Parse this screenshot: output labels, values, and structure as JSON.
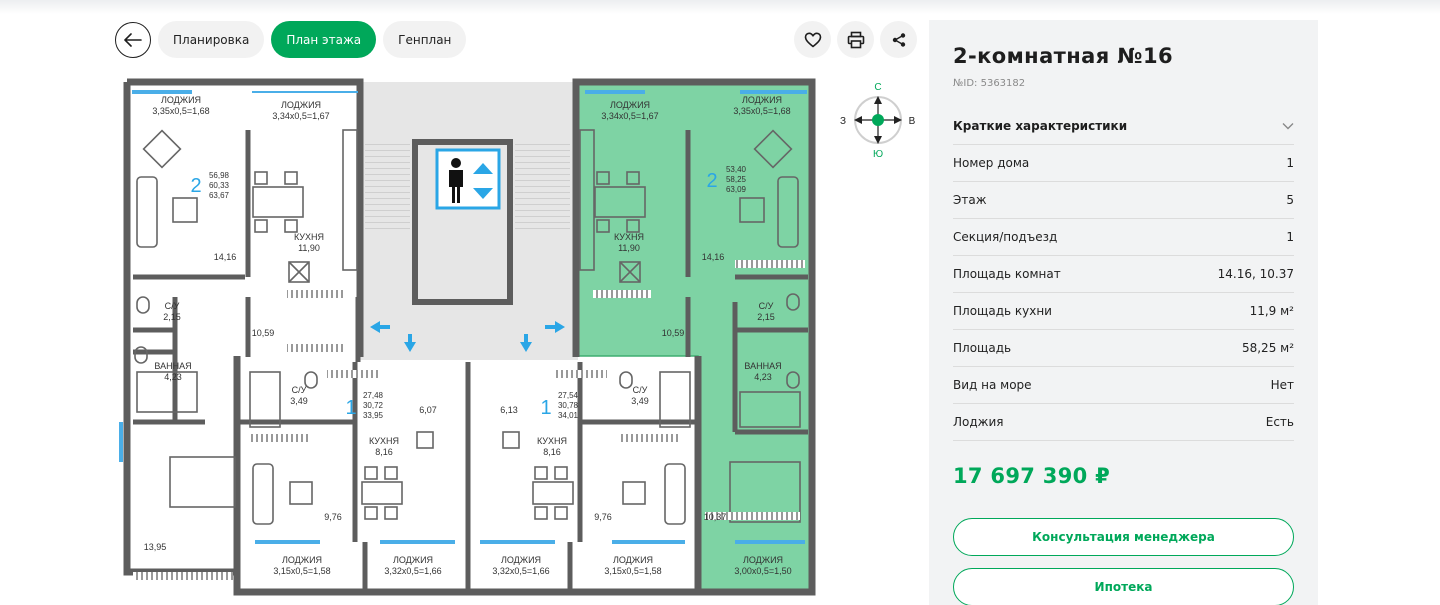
{
  "tabs": [
    {
      "label": "Планировка",
      "active": false
    },
    {
      "label": "План этажа",
      "active": true
    },
    {
      "label": "Генплан",
      "active": false
    }
  ],
  "icons": {
    "back": "arrow-left-icon",
    "favorite": "heart-icon",
    "print": "printer-icon",
    "share": "share-icon",
    "collapse": "chevron-down-icon"
  },
  "colors": {
    "accent": "#00a85a",
    "highlight": "#7ed3a4",
    "window": "#4aaee8"
  },
  "compass": {
    "n": "С",
    "s": "Ю",
    "w": "З",
    "e": "В"
  },
  "plan": {
    "left_loggia_1": "ЛОДЖИЯ",
    "left_loggia_1_size": "3,35х0,5=1,68",
    "left_loggia_2": "ЛОДЖИЯ",
    "left_loggia_2_size": "3,34х0,5=1,67",
    "right_loggia_1": "ЛОДЖИЯ",
    "right_loggia_1_size": "3,34х0,5=1,67",
    "right_loggia_2": "ЛОДЖИЯ",
    "right_loggia_2_size": "3,35х0,5=1,68",
    "left_rooms": "2",
    "left_area_1": "56,98",
    "left_area_2": "60,33",
    "left_area_3": "63,67",
    "right_rooms": "2",
    "right_area_1": "53,40",
    "right_area_2": "58,25",
    "right_area_3": "63,09",
    "left_kitchen": "КУХНЯ",
    "left_kitchen_area": "11,90",
    "right_kitchen": "КУХНЯ",
    "right_kitchen_area": "11,90",
    "left_room_area": "14,16",
    "right_room_area": "14,16",
    "left_wc": "С/У",
    "left_wc_area": "2,15",
    "right_wc": "С/У",
    "right_wc_area": "2,15",
    "left_hall_area": "10,59",
    "right_hall_area": "10,59",
    "left_bath": "ВАННАЯ",
    "left_bath_area": "4,23",
    "right_bath": "ВАННАЯ",
    "right_bath_area": "4,23",
    "mid_l_wc": "С/У",
    "mid_l_wc_area": "3,49",
    "mid_r_wc": "С/У",
    "mid_r_wc_area": "3,49",
    "mid_l_rooms": "1",
    "mid_l_area_1": "27,48",
    "mid_l_area_2": "30,72",
    "mid_l_area_3": "33,95",
    "mid_r_rooms": "1",
    "mid_r_area_1": "27,54",
    "mid_r_area_2": "30,78",
    "mid_r_area_3": "34,01",
    "mid_l_hall": "6,07",
    "mid_r_hall": "6,13",
    "mid_l_kitchen": "КУХНЯ",
    "mid_l_kitchen_area": "8,16",
    "mid_r_kitchen": "КУХНЯ",
    "mid_r_kitchen_area": "8,16",
    "mid_l_room": "9,76",
    "mid_r_room": "9,76",
    "left_bedroom": "13,95",
    "right_bedroom": "10,37",
    "bottom_loggia_1": "ЛОДЖИЯ",
    "bottom_loggia_1_size": "3,15х0,5=1,58",
    "bottom_loggia_2": "ЛОДЖИЯ",
    "bottom_loggia_2_size": "3,32х0,5=1,66",
    "bottom_loggia_3": "ЛОДЖИЯ",
    "bottom_loggia_3_size": "3,32х0,5=1,66",
    "bottom_loggia_4": "ЛОДЖИЯ",
    "bottom_loggia_4_size": "3,15х0,5=1,58",
    "bottom_loggia_5": "ЛОДЖИЯ",
    "bottom_loggia_5_size": "3,00х0,5=1,50"
  },
  "apartment": {
    "title": "2-комнатная №16",
    "id": "№ID: 5363182",
    "specs_title": "Краткие характеристики",
    "specs": [
      {
        "key": "Номер дома",
        "value": "1"
      },
      {
        "key": "Этаж",
        "value": "5"
      },
      {
        "key": "Секция/подъезд",
        "value": "1"
      },
      {
        "key": "Площадь комнат",
        "value": "14.16, 10.37"
      },
      {
        "key": "Площадь кухни",
        "value": "11,9 м²"
      },
      {
        "key": "Площадь",
        "value": "58,25 м²"
      },
      {
        "key": "Вид на море",
        "value": "Нет"
      },
      {
        "key": "Лоджия",
        "value": "Есть"
      }
    ],
    "price": "17 697 390 ₽",
    "consult_label": "Консультация менеджера",
    "mortgage_label": "Ипотека"
  }
}
